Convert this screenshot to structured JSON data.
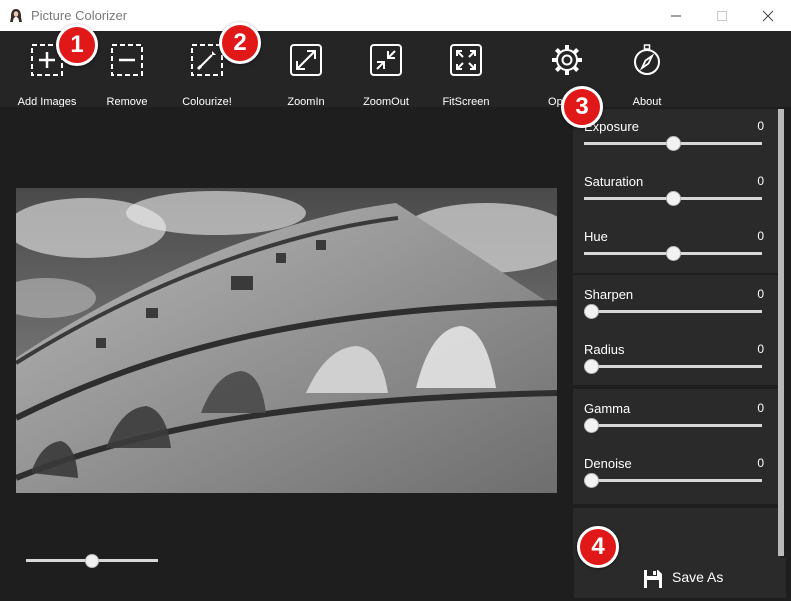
{
  "window": {
    "title": "Picture Colorizer",
    "controls": {
      "minimize": "minimize-icon",
      "maximize": "maximize-icon",
      "close": "close-icon"
    }
  },
  "toolbar": {
    "items": [
      {
        "label": "Add Images",
        "icon": "add-icon"
      },
      {
        "label": "Remove",
        "icon": "remove-icon"
      },
      {
        "label": "Colourize!",
        "icon": "magic-wand-icon"
      },
      {
        "label": "ZoomIn",
        "icon": "zoom-in-icon"
      },
      {
        "label": "ZoomOut",
        "icon": "zoom-out-icon"
      },
      {
        "label": "FitScreen",
        "icon": "fit-screen-icon"
      },
      {
        "label": "Options",
        "icon": "gear-icon"
      },
      {
        "label": "About",
        "icon": "compass-icon"
      }
    ]
  },
  "canvas": {
    "zoom_level": 0.5
  },
  "adjustments": {
    "exposure": {
      "label": "Exposure",
      "value": "0",
      "position": 0.5
    },
    "saturation": {
      "label": "Saturation",
      "value": "0",
      "position": 0.5
    },
    "hue": {
      "label": "Hue",
      "value": "0",
      "position": 0.5
    },
    "sharpen": {
      "label": "Sharpen",
      "value": "0",
      "position": 0
    },
    "radius": {
      "label": "Radius",
      "value": "0",
      "position": 0
    },
    "gamma": {
      "label": "Gamma",
      "value": "0",
      "position": 0
    },
    "denoise": {
      "label": "Denoise",
      "value": "0",
      "position": 0
    }
  },
  "save": {
    "label": "Save As",
    "icon": "floppy-disk-icon"
  },
  "badges": [
    "1",
    "2",
    "3",
    "4"
  ],
  "colors": {
    "badge": "#e01818",
    "toolbar": "#252526",
    "background": "#1e1e1e",
    "panel_group": "#2a2a2b"
  }
}
